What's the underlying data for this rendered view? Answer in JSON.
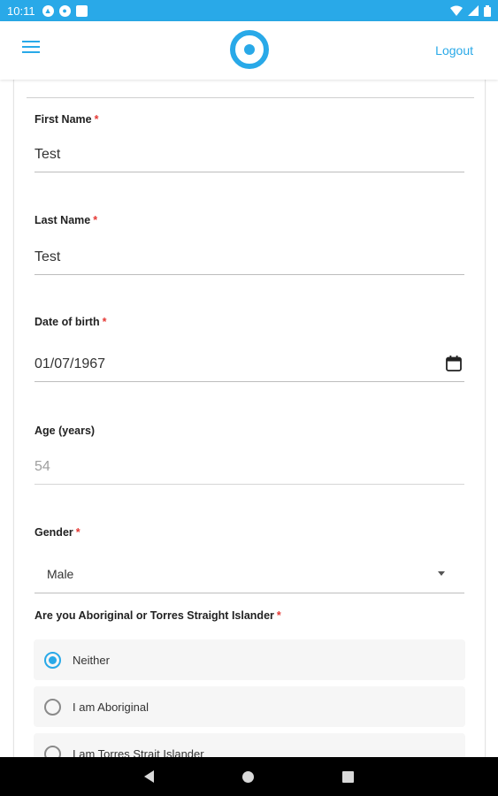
{
  "status_bar": {
    "time": "10:11",
    "icons": [
      "navigation-icon",
      "ring-icon",
      "sim-card-icon"
    ],
    "right_icons": [
      "wifi-icon",
      "signal-icon",
      "battery-icon"
    ]
  },
  "app_bar": {
    "menu_icon": "hamburger-menu-icon",
    "logo": "ring-logo",
    "logout_label": "Logout",
    "accent_color": "#29a9e8"
  },
  "form": {
    "first_name": {
      "label": "First Name",
      "required_mark": "*",
      "value": "Test"
    },
    "last_name": {
      "label": "Last Name",
      "required_mark": "*",
      "value": "Test"
    },
    "dob": {
      "label": "Date of birth",
      "required_mark": "*",
      "value": "01/07/1967",
      "icon": "calendar-icon"
    },
    "age": {
      "label": "Age (years)",
      "value": "54"
    },
    "gender": {
      "label": "Gender",
      "required_mark": "*",
      "selected": "Male"
    },
    "indigenous": {
      "label": "Are you Aboriginal or Torres Straight Islander",
      "required_mark": "*",
      "options": [
        {
          "label": "Neither",
          "checked": true
        },
        {
          "label": "I am Aboriginal",
          "checked": false
        },
        {
          "label": "I am Torres Strait Islander",
          "checked": false
        }
      ]
    }
  },
  "nav_bar": {
    "buttons": [
      "back-icon",
      "home-icon",
      "recents-icon"
    ]
  }
}
